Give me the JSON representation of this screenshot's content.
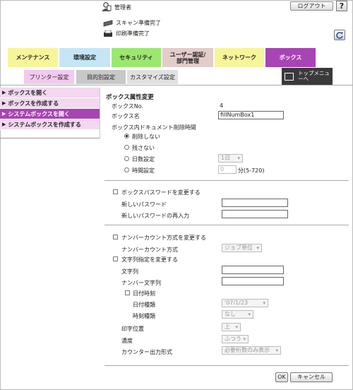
{
  "header": {
    "user_label": "管理者",
    "logout_label": "ログアウト",
    "help_label": "?",
    "scan_status": "スキャン準備完了",
    "print_status": "印刷準備完了"
  },
  "tabs": [
    {
      "label": "メンテナンス",
      "color": "#f7f59a"
    },
    {
      "label": "環境設定",
      "color": "#c6e6f6"
    },
    {
      "label": "セキュリティ",
      "color": "#9be86f"
    },
    {
      "label": "ユーザー認証/部門管理",
      "color": "#e3ccc9"
    },
    {
      "label": "ネットワーク",
      "color": "#f7f59a"
    },
    {
      "label": "ボックス",
      "color": "#a844b4"
    }
  ],
  "subtabs": [
    {
      "label": "プリンター設定"
    },
    {
      "label": "目的別設定"
    },
    {
      "label": "カスタマイズ設定"
    }
  ],
  "top_menu_label": "トップメニューへ",
  "sidebar": {
    "items": [
      {
        "label": "ボックスを開く",
        "active": false
      },
      {
        "label": "ボックスを作成する",
        "active": false
      },
      {
        "label": "システムボックスを開く",
        "active": true
      },
      {
        "label": "システムボックスを作成する",
        "active": false
      }
    ]
  },
  "form": {
    "section_title": "ボックス属性変更",
    "box_no_label": "ボックスNo.",
    "box_no_value": "4",
    "box_name_label": "ボックス名",
    "box_name_value": "fillNumBox1",
    "delete_time_label": "ボックス内ドキュメント削除時間",
    "opt_no_delete": "削除しない",
    "opt_no_keep": "残さない",
    "opt_days": "日数設定",
    "days_value": "1日",
    "opt_time": "時間設定",
    "time_value": "0",
    "time_unit": "分(5-720)",
    "change_pw_label": "ボックスパスワードを変更する",
    "new_pw_label": "新しいパスワード",
    "new_pw_confirm_label": "新しいパスワードの再入力",
    "numbering_change_label": "ナンバーカウント方式を変更する",
    "numbering_method_label": "ナンバーカウント方式",
    "numbering_method_value": "ジョブ単位",
    "string_change_label": "文字列指定を変更する",
    "string_label": "文字列",
    "number_string_label": "ナンバー文字列",
    "datetime_label": "日付時刻",
    "date_type_label": "日付種類",
    "date_type_value": "'07/1/23",
    "time_type_label": "時刻種類",
    "time_type_value": "なし",
    "print_pos_label": "印字位置",
    "print_pos_value": "上",
    "density_label": "濃度",
    "density_value": "ふつう",
    "counter_format_label": "カウンター出力形式",
    "counter_format_value": "必要桁数のみ表示",
    "ok_label": "OK",
    "cancel_label": "キャンセル"
  }
}
